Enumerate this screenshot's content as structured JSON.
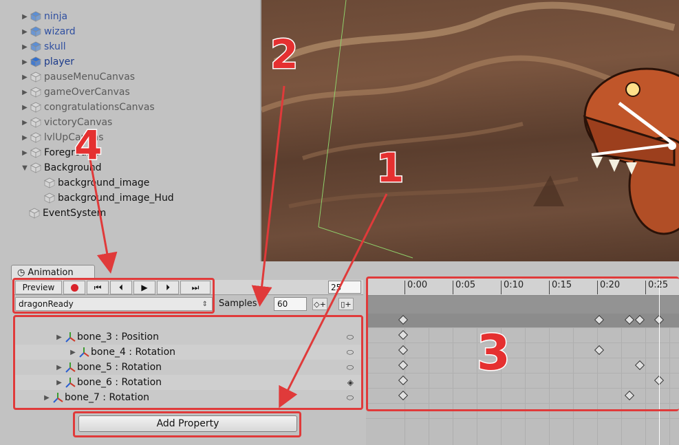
{
  "hierarchy": {
    "items": [
      {
        "label": "ninja",
        "state": "active"
      },
      {
        "label": "wizard",
        "state": "active"
      },
      {
        "label": "skull",
        "state": "active"
      },
      {
        "label": "player",
        "state": "selected"
      },
      {
        "label": "pauseMenuCanvas",
        "state": "inactive"
      },
      {
        "label": "gameOverCanvas",
        "state": "inactive"
      },
      {
        "label": "congratulationsCanvas",
        "state": "inactive"
      },
      {
        "label": "victoryCanvas",
        "state": "inactive"
      },
      {
        "label": "lvlUpCanvas",
        "state": "inactive"
      },
      {
        "label": "Foreground",
        "state": "normal"
      },
      {
        "label": "Background",
        "state": "normal"
      },
      {
        "label": "background_image",
        "state": "normal"
      },
      {
        "label": "background_image_Hud",
        "state": "normal"
      },
      {
        "label": "EventSystem",
        "state": "normal"
      }
    ]
  },
  "animation": {
    "tab_label": "Animation",
    "preview_label": "Preview",
    "frame_value": "25",
    "clip_name": "dragonReady",
    "samples_label": "Samples",
    "samples_value": "60",
    "add_property_label": "Add Property",
    "properties": [
      {
        "label": "bone_3 : Position",
        "keyframe_icon": "key-diamond-outline-icon"
      },
      {
        "label": "bone_4 : Rotation",
        "keyframe_icon": "key-diamond-outline-icon"
      },
      {
        "label": "bone_5 : Rotation",
        "keyframe_icon": "key-diamond-outline-icon"
      },
      {
        "label": "bone_6 : Rotation",
        "keyframe_icon": "key-diamond-filled-icon"
      },
      {
        "label": "bone_7 : Rotation",
        "keyframe_icon": "key-diamond-outline-icon"
      }
    ],
    "timeline_ticks": [
      "0:00",
      "0:05",
      "0:10",
      "0:15",
      "0:20",
      "0:25"
    ]
  },
  "annotations": {
    "numbers": [
      "1",
      "2",
      "3",
      "4"
    ],
    "highlight_color": "#e03a3a"
  }
}
